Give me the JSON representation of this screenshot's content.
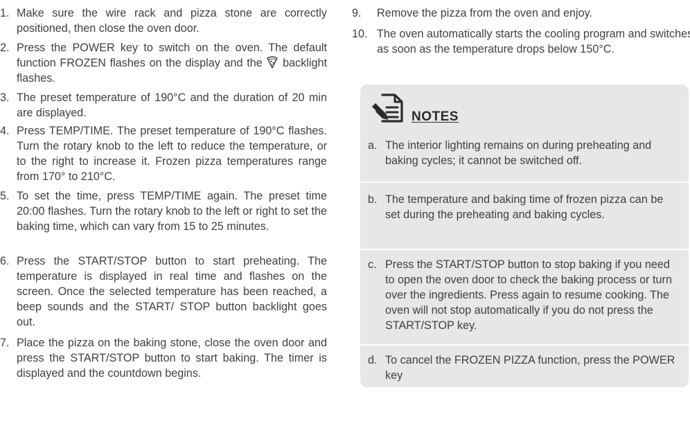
{
  "left_steps": [
    {
      "num": "1.",
      "text": "Make sure the wire rack and pizza stone are correctly positioned, then close the oven door."
    },
    {
      "num": "2.",
      "text_before_icon": "Press the POWER key to switch on the oven. The default function FROZEN flashes on the display and the ",
      "icon": "pizza-slice-icon",
      "text_after_icon": " backlight flashes."
    },
    {
      "num": "3.",
      "text": "The preset temperature of 190°C and the duration of 20 min are displayed."
    },
    {
      "num": "4.",
      "text": "Press TEMP/TIME. The preset temperature of 190°C flashes. Turn the rotary knob to the left to reduce the temperature, or to the right to increase it. Frozen pizza temperatures range from 170° to 210°C."
    },
    {
      "num": "5.",
      "text": "To set the time, press TEMP/TIME again. The preset time 20:00 flashes. Turn the rotary knob to the left or right to set the baking time, which can vary from 15 to 25 minutes."
    },
    {
      "num": "6.",
      "text": "Press the START/STOP button to start preheating. The temperature is displayed in real time and flashes on the screen. Once the selected temperature has been reached, a beep sounds and the START/ STOP button backlight goes out."
    },
    {
      "num": "7.",
      "text": "Place the pizza on the baking stone, close the oven door and press the START/STOP button to start baking. The timer is displayed and the countdown begins."
    }
  ],
  "right_steps": [
    {
      "num": "9.",
      "text": "Remove the pizza from the oven and enjoy."
    },
    {
      "num": "10.",
      "text": "The oven automatically starts the cooling program and switches off as soon as the temperature drops below 150°C."
    }
  ],
  "notes": {
    "title": "NOTES",
    "icon": "notes-document-pen-icon",
    "items": [
      {
        "letter": "a.",
        "text": "The interior lighting remains on during preheating and baking cycles; it cannot be switched off."
      },
      {
        "letter": "b.",
        "text": "The temperature and baking time of frozen pizza can be set during the preheating and baking cycles."
      },
      {
        "letter": "c.",
        "text": "Press the START/STOP button to stop baking if you need to open the oven door to check the baking process or turn over the ingredients. Press again to resume cooking. The oven will not stop automatically if you do not press the START/STOP key."
      },
      {
        "letter": "d.",
        "text": "To cancel the FROZEN PIZZA function, press the POWER key"
      }
    ]
  },
  "colors": {
    "text": "#404041",
    "notes_background": "#e7e7e8",
    "divider": "#ffffff"
  }
}
